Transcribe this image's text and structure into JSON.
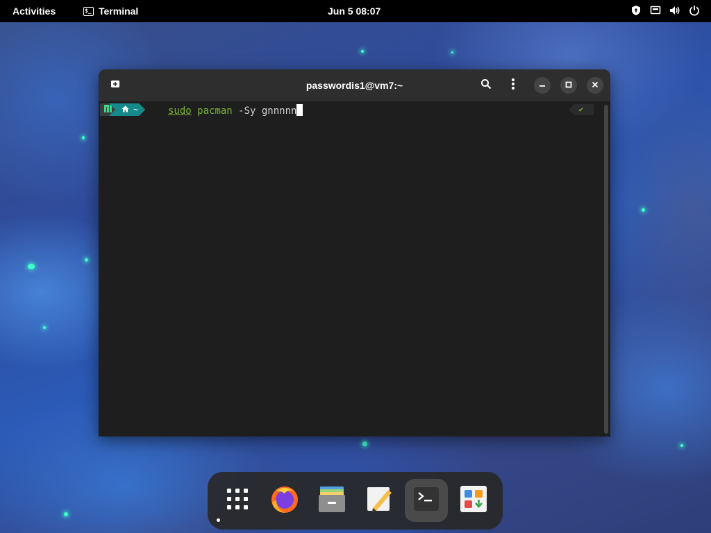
{
  "topbar": {
    "activities_label": "Activities",
    "app_name": "Terminal",
    "app_icon_glyph": "$_",
    "clock": "Jun 5  08:07",
    "tray_icons": [
      "privacy-shield-icon",
      "network-icon",
      "volume-icon",
      "power-icon"
    ]
  },
  "window": {
    "title": "passwordis1@vm7:~",
    "buttons": [
      "new-tab-icon",
      "search-icon",
      "menu-kebab-icon",
      "minimize-icon",
      "maximize-icon",
      "close-icon"
    ]
  },
  "terminal": {
    "prompt": {
      "os_icon": "manjaro-icon",
      "dir_icon": "home-icon",
      "dir_label": "~"
    },
    "command": {
      "word_sudo": "sudo",
      "word_pacman": "pacman",
      "rest": " -Sy gnnnnn"
    },
    "status_glyph": "✔"
  },
  "dock": {
    "items": [
      "app-grid-icon",
      "firefox-icon",
      "files-icon",
      "text-editor-icon",
      "terminal-icon",
      "software-icon"
    ],
    "active_item": "terminal-icon"
  },
  "colors": {
    "prompt_teal": "#16898a",
    "command_green": "#7ab532",
    "terminal_bg": "#1e1e1e",
    "header_bg": "#2e2e2e"
  }
}
